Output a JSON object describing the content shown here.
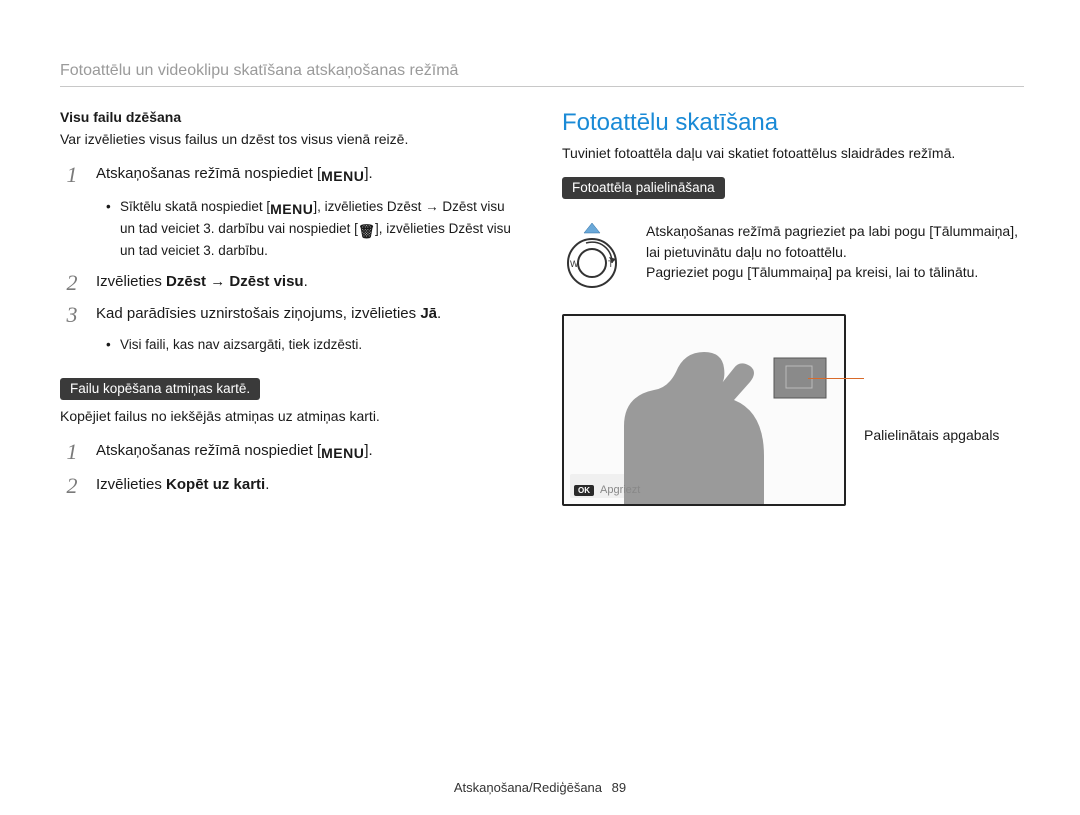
{
  "header": "Fotoattēlu un videoklipu skatīšana atskaņošanas režīmā",
  "left": {
    "subhead1": "Visu failu dzēšana",
    "body1": "Var izvēlieties visus failus un dzēst tos visus vienā reizē.",
    "steps1": {
      "s1_pre": "Atskaņošanas režīmā nospiediet [",
      "s1_icon": "MENU",
      "s1_post": "].",
      "b1_pre": "Sīktēlu skatā nospiediet [",
      "b1_icon": "MENU",
      "b1_mid": "], izvēlieties ",
      "b1_bold1": "Dzēst",
      "b1_arrow": " → ",
      "b1_bold2": "Dzēst visu",
      "b1_mid2": " un tad veiciet 3. darbību vai nospiediet [",
      "b1_icon2": "🗑",
      "b1_mid3": "], izvēlieties ",
      "b1_bold3": "Dzēst visu",
      "b1_end": " un tad veiciet 3. darbību.",
      "s2_pre": "Izvēlieties ",
      "s2_bold1": "Dzēst",
      "s2_arrow": " → ",
      "s2_bold2": "Dzēst visu",
      "s2_end": ".",
      "s3_pre": "Kad parādīsies uznirstošais ziņojums, izvēlieties ",
      "s3_bold": "Jā",
      "s3_end": ".",
      "b3": "Visi faili, kas nav aizsargāti, tiek izdzēsti."
    },
    "pill": "Failu kopēšana atmiņas kartē.",
    "body2": "Kopējiet failus no iekšējās atmiņas uz atmiņas karti.",
    "steps2": {
      "s1_pre": "Atskaņošanas režīmā nospiediet [",
      "s1_icon": "MENU",
      "s1_post": "].",
      "s2_pre": "Izvēlieties ",
      "s2_bold": "Kopēt uz karti",
      "s2_end": "."
    }
  },
  "right": {
    "section_title": "Fotoattēlu skatīšana",
    "intro": "Tuviniet fotoattēla daļu vai skatiet fotoattēlus slaidrādes režīmā.",
    "pill": "Fotoattēla palielināšana",
    "rotate": {
      "l1_pre": "Atskaņošanas režīmā pagrieziet pa labi pogu ",
      "l1_bold": "[Tālummaiņa]",
      "l1_end": ", lai pietuvinātu daļu no fotoattēlu.",
      "l2_pre": "Pagrieziet pogu ",
      "l2_bold": "[Tālummaiņa]",
      "l2_end": " pa kreisi, lai to tālinātu."
    },
    "callout": "Palielinātais apgabals",
    "ok_label": "OK",
    "ok_text": "Apgriezt"
  },
  "footer": {
    "section": "Atskaņošana/Rediģēšana",
    "page": "89"
  },
  "nums": {
    "n1": "1",
    "n2": "2",
    "n3": "3"
  }
}
